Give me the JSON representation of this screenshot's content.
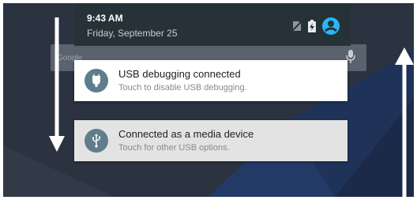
{
  "status_bar": {
    "time": "9:43 AM",
    "date": "Friday, September 25"
  },
  "search": {
    "hint": "Google"
  },
  "notifications": [
    {
      "title": "USB debugging connected",
      "subtitle": "Touch to disable USB debugging.",
      "icon": "android-debug-icon"
    },
    {
      "title": "Connected as a media device",
      "subtitle": "Touch for other USB options.",
      "icon": "usb-icon"
    }
  ],
  "colors": {
    "shade_header": "#263238",
    "notification_icon_bg": "#607d8b",
    "account_icon": "#29b6f6",
    "wallpaper": "#2b3240"
  }
}
